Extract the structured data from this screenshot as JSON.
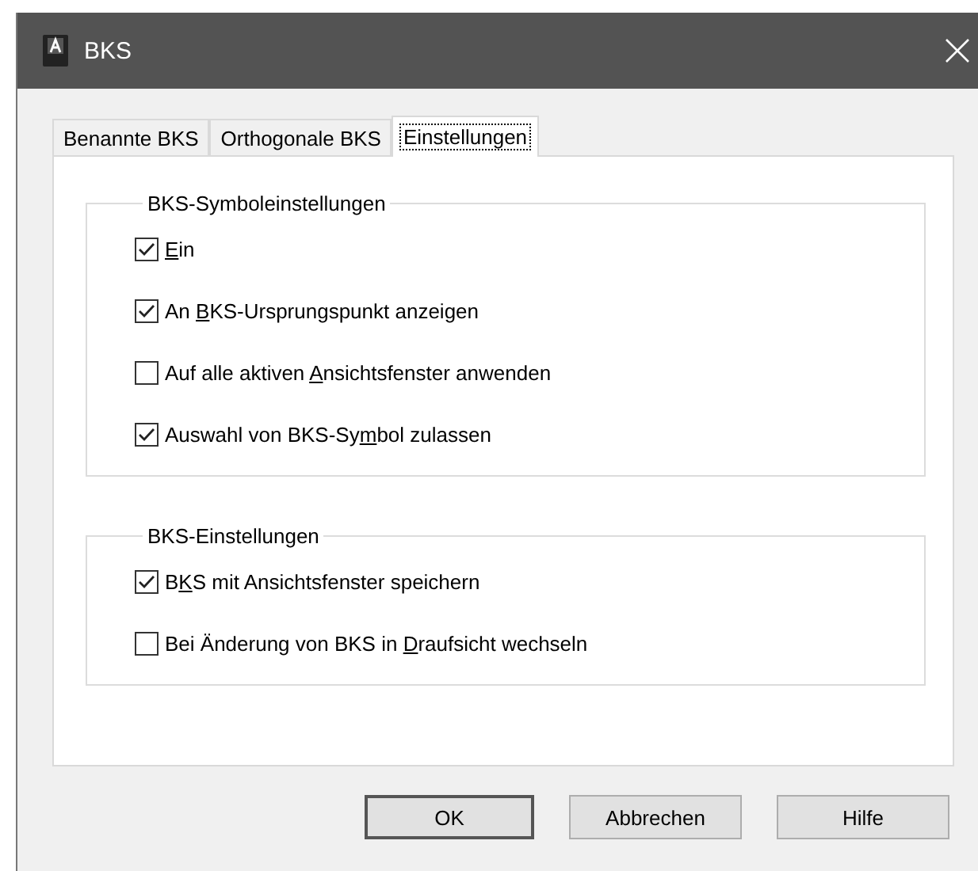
{
  "window": {
    "title": "BKS"
  },
  "tabs": [
    {
      "label": "Benannte BKS",
      "selected": false
    },
    {
      "label": "Orthogonale BKS",
      "selected": false
    },
    {
      "label": "Einstellungen",
      "selected": true
    }
  ],
  "groups": [
    {
      "title": "BKS-Symboleinstellungen",
      "options": [
        {
          "key": "E",
          "post": "in",
          "checked": true
        },
        {
          "pre": "An ",
          "key": "B",
          "post": "KS-Ursprungspunkt anzeigen",
          "checked": true
        },
        {
          "pre": "Auf alle aktiven ",
          "key": "A",
          "post": "nsichtsfenster anwenden",
          "checked": false
        },
        {
          "pre": "Auswahl von BKS-Sy",
          "key": "m",
          "post": "bol zulassen",
          "checked": true
        }
      ]
    },
    {
      "title": "BKS-Einstellungen",
      "options": [
        {
          "pre": "B",
          "key": "K",
          "post": "S mit Ansichtsfenster speichern",
          "checked": true
        },
        {
          "pre": "Bei Änderung von BKS in ",
          "key": "D",
          "post": "raufsicht wechseln",
          "checked": false
        }
      ]
    }
  ],
  "buttons": [
    {
      "label": "OK",
      "default": true
    },
    {
      "label": "Abbrechen",
      "default": false
    },
    {
      "label": "Hilfe",
      "default": false
    }
  ]
}
